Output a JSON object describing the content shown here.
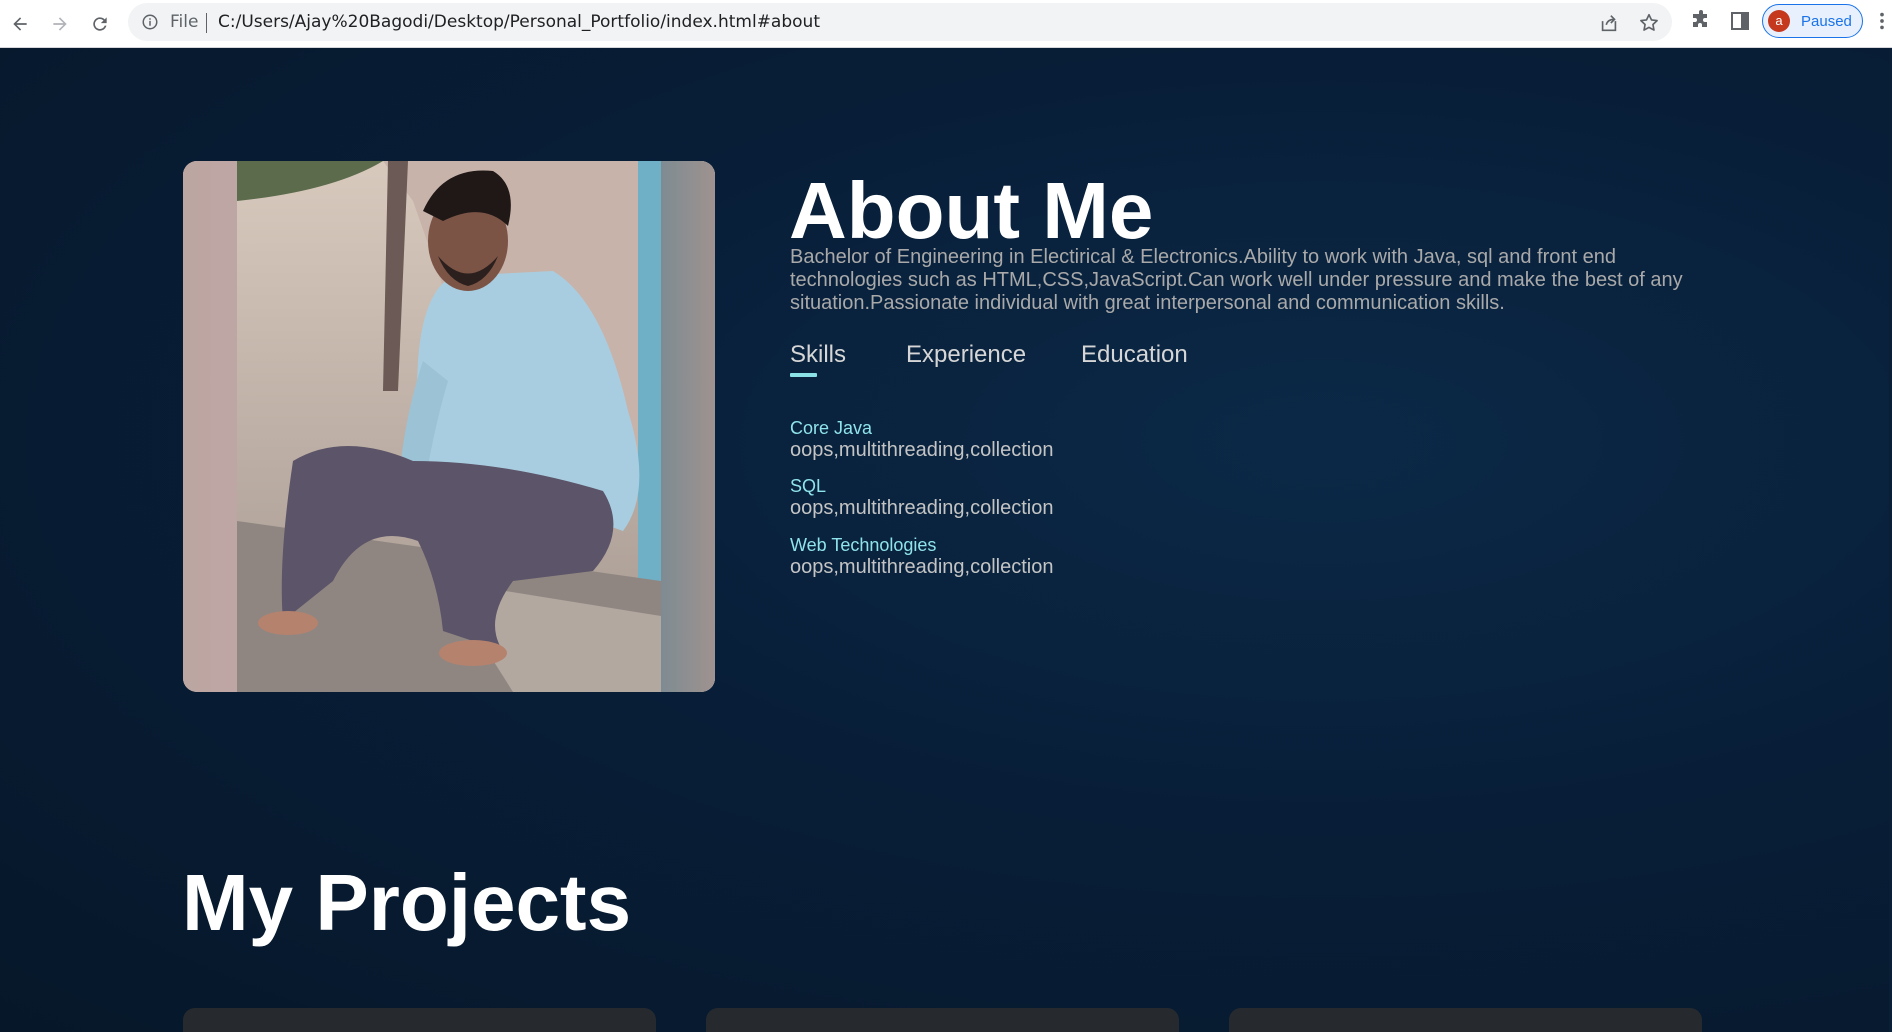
{
  "browser": {
    "scheme": "File",
    "url": "C:/Users/Ajay%20Bagodi/Desktop/Personal_Portfolio/index.html#about",
    "profile_initial": "a",
    "profile_status": "Paused"
  },
  "about": {
    "title": "About Me",
    "description": "Bachelor of Engineering in Electirical & Electronics.Ability to work with Java, sql and front end technologies such as HTML,CSS,JavaScript.Can work well under pressure and make the best of any situation.Passionate individual with great interpersonal and communication skills.",
    "tabs": [
      {
        "label": "Skills",
        "active": true
      },
      {
        "label": "Experience",
        "active": false
      },
      {
        "label": "Education",
        "active": false
      }
    ],
    "skills": [
      {
        "name": "Core Java",
        "detail": "oops,multithreading,collection"
      },
      {
        "name": "SQL",
        "detail": "oops,multithreading,collection"
      },
      {
        "name": "Web Technologies",
        "detail": "oops,multithreading,collection"
      }
    ]
  },
  "projects": {
    "title": "My Projects",
    "card_count": 3
  },
  "colors": {
    "page_background": "#081e38",
    "accent": "#8ae1e6",
    "title": "#ffffff",
    "body_text": "#a9a9a9",
    "card": "#262a2f"
  },
  "icons": {
    "back": "arrow-left-icon",
    "forward": "arrow-right-icon",
    "reload": "reload-icon",
    "info": "info-icon",
    "share": "share-icon",
    "bookmark": "star-icon",
    "extensions": "puzzle-icon",
    "side_panel": "side-panel-icon",
    "menu": "kebab-menu-icon"
  }
}
